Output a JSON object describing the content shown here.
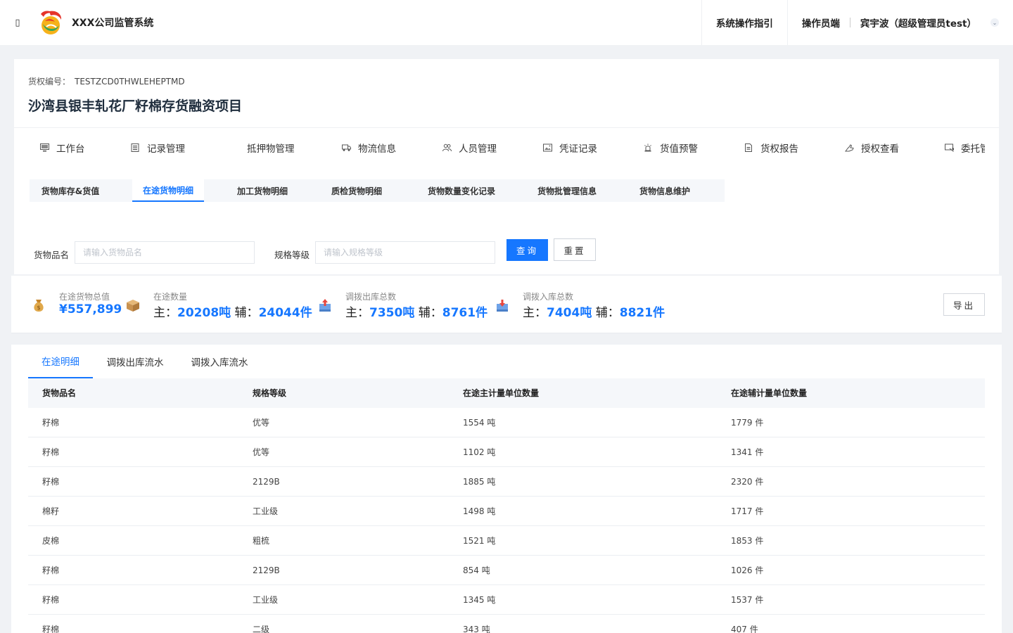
{
  "header": {
    "menu_toggle": "▯",
    "app_title": "XXX公司监管系统",
    "guide_label": "系统操作指引",
    "operator_label": "操作员端",
    "user_name": "宾宇波（超级管理员test）",
    "user_chevron": "⌄"
  },
  "project": {
    "code_label": "货权编号：",
    "code_value": "TESTZCD0THWLEHEPTMD",
    "title": "沙湾县银丰轧花厂籽棉存货融资项目"
  },
  "main_nav": [
    {
      "label": "工作台",
      "icon": "monitor-icon"
    },
    {
      "label": "记录管理",
      "icon": "document-icon"
    },
    {
      "label": "抵押物管理",
      "icon": ""
    },
    {
      "label": "物流信息",
      "icon": "truck-icon"
    },
    {
      "label": "人员管理",
      "icon": "users-icon"
    },
    {
      "label": "凭证记录",
      "icon": "image-icon"
    },
    {
      "label": "货值预警",
      "icon": "alarm-icon"
    },
    {
      "label": "货权报告",
      "icon": "report-icon"
    },
    {
      "label": "授权查看",
      "icon": "hand-icon"
    },
    {
      "label": "委托管",
      "icon": "delegate-icon"
    }
  ],
  "sub_tabs": [
    {
      "label": "货物库存&货值"
    },
    {
      "label": "在途货物明细",
      "active": true
    },
    {
      "label": "加工货物明细"
    },
    {
      "label": "质检货物明细"
    },
    {
      "label": "货物数量变化记录"
    },
    {
      "label": "货物批管理信息"
    },
    {
      "label": "货物信息维护"
    }
  ],
  "filters": {
    "name_label": "货物品名",
    "name_placeholder": "请输入货物品名",
    "grade_label": "规格等级",
    "grade_placeholder": "请输入规格等级",
    "search_button": "查询",
    "reset_button": "重置"
  },
  "stats": {
    "total_value": {
      "label": "在途货物总值",
      "value": "¥557,899"
    },
    "quantity": {
      "label": "在途数量",
      "main_prefix": "主：",
      "main_value": "20208",
      "main_unit": "吨",
      "aux_prefix": " 辅：",
      "aux_value": "24044",
      "aux_unit": "件"
    },
    "out_total": {
      "label": "调拨出库总数",
      "main_prefix": "主：",
      "main_value": "7350",
      "main_unit": "吨",
      "aux_prefix": " 辅：",
      "aux_value": "8761",
      "aux_unit": "件"
    },
    "in_total": {
      "label": "调拨入库总数",
      "main_prefix": "主：",
      "main_value": "7404",
      "main_unit": "吨",
      "aux_prefix": " 辅：",
      "aux_value": "8821",
      "aux_unit": "件"
    },
    "export_button": "导出"
  },
  "table_tabs": [
    {
      "label": "在途明细",
      "active": true
    },
    {
      "label": "调拨出库流水"
    },
    {
      "label": "调拨入库流水"
    }
  ],
  "table": {
    "columns": [
      "货物品名",
      "规格等级",
      "在途主计量单位数量",
      "在途辅计量单位数量"
    ],
    "rows": [
      [
        "籽棉",
        "优等",
        "1554 吨",
        "1779 件"
      ],
      [
        "籽棉",
        "优等",
        "1102 吨",
        "1341 件"
      ],
      [
        "籽棉",
        "2129B",
        "1885 吨",
        "2320 件"
      ],
      [
        "棉籽",
        "工业级",
        "1498 吨",
        "1717 件"
      ],
      [
        "皮棉",
        "粗梳",
        "1521 吨",
        "1853 件"
      ],
      [
        "籽棉",
        "2129B",
        "854 吨",
        "1026 件"
      ],
      [
        "籽棉",
        "工业级",
        "1345 吨",
        "1537 件"
      ],
      [
        "籽棉",
        "二级",
        "343 吨",
        "407 件"
      ]
    ]
  },
  "colors": {
    "accent": "#1677ff",
    "title": "#1f2d3d"
  }
}
